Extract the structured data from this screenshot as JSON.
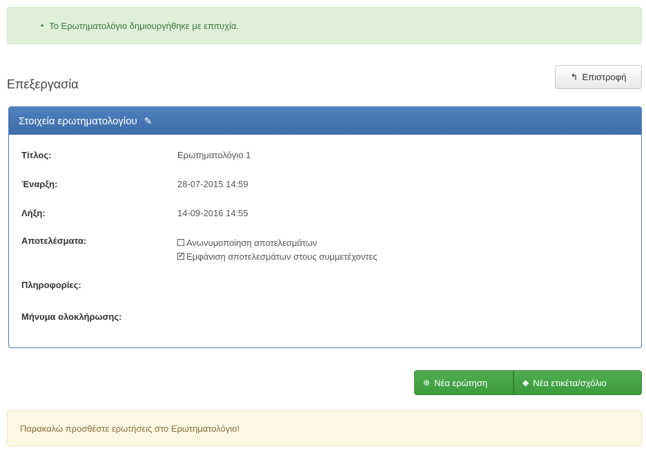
{
  "success_alert": {
    "bullet": "•",
    "text": "Το Ερωτηματολόγιο δημιουργήθηκε με επιτυχία."
  },
  "page": {
    "title": "Επεξεργασία",
    "back_button": "Επιστροφή",
    "back_icon": "↰"
  },
  "panel": {
    "title": "Στοιχεία ερωτηματολογίου",
    "edit_icon": "✎",
    "fields": {
      "title_label": "Τίτλος:",
      "title_value": "Ερωτηματολόγιο 1",
      "start_label": "Έναρξη:",
      "start_value": "28-07-2015 14:59",
      "end_label": "Λήξη:",
      "end_value": "14-09-2016 14:55",
      "results_label": "Αποτελέσματα:",
      "anonymize_label": "Ανωνυμοποίηση αποτελεσμάτων",
      "anonymize_checked": false,
      "show_results_label": "Εμφάνιση αποτελεσμάτων στους συμμετέχοντες",
      "show_results_checked": true,
      "info_label": "Πληροφορίες:",
      "completion_label": "Μήνυμα ολοκλήρωσης:"
    }
  },
  "actions": {
    "new_question": "Νέα ερώτηση",
    "new_question_icon": "⊕",
    "new_label": "Νέα ετικέτα/σχόλιο",
    "new_label_icon": "◆"
  },
  "warning_alert": {
    "text": "Παρακαλώ προσθέστε ερωτήσεις στο Ερωτηματολόγιο!"
  },
  "colors": {
    "panel_heading": "#3e6ea9",
    "success_bg": "#dff0d8",
    "warning_bg": "#fcf8e3",
    "button_green": "#3c9a3c"
  }
}
